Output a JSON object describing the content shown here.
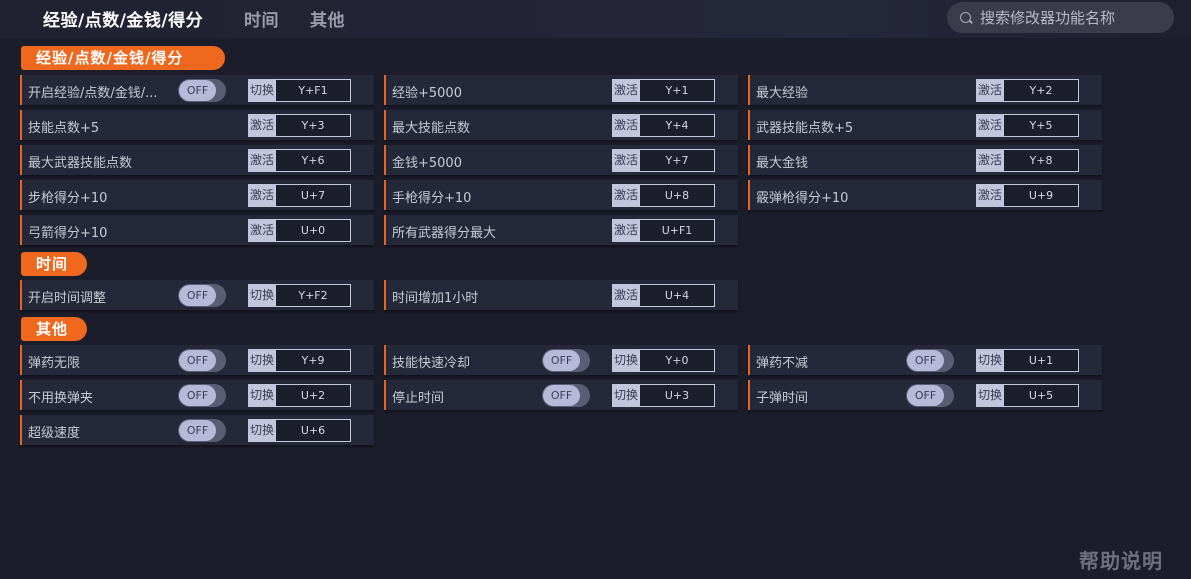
{
  "tabs": [
    {
      "label": "经验/点数/金钱/得分",
      "active": true
    },
    {
      "label": "时间",
      "active": false
    },
    {
      "label": "其他",
      "active": false
    }
  ],
  "search": {
    "placeholder": "搜索修改器功能名称"
  },
  "sections": [
    {
      "title": "经验/点数/金钱/得分",
      "rows": [
        {
          "label": "开启经验/点数/金钱/...",
          "toggle": "OFF",
          "action": "切换",
          "key": "Y+F1"
        },
        {
          "label": "经验+5000",
          "action": "激活",
          "key": "Y+1"
        },
        {
          "label": "最大经验",
          "action": "激活",
          "key": "Y+2"
        },
        {
          "label": "技能点数+5",
          "action": "激活",
          "key": "Y+3"
        },
        {
          "label": "最大技能点数",
          "action": "激活",
          "key": "Y+4"
        },
        {
          "label": "武器技能点数+5",
          "action": "激活",
          "key": "Y+5"
        },
        {
          "label": "最大武器技能点数",
          "action": "激活",
          "key": "Y+6"
        },
        {
          "label": "金钱+5000",
          "action": "激活",
          "key": "Y+7"
        },
        {
          "label": "最大金钱",
          "action": "激活",
          "key": "Y+8"
        },
        {
          "label": "步枪得分+10",
          "action": "激活",
          "key": "U+7"
        },
        {
          "label": "手枪得分+10",
          "action": "激活",
          "key": "U+8"
        },
        {
          "label": "霰弹枪得分+10",
          "action": "激活",
          "key": "U+9"
        },
        {
          "label": "弓箭得分+10",
          "action": "激活",
          "key": "U+0"
        },
        {
          "label": "所有武器得分最大",
          "action": "激活",
          "key": "U+F1"
        }
      ]
    },
    {
      "title": "时间",
      "rows": [
        {
          "label": "开启时间调整",
          "toggle": "OFF",
          "action": "切换",
          "key": "Y+F2"
        },
        {
          "label": "时间增加1小时",
          "action": "激活",
          "key": "U+4"
        }
      ]
    },
    {
      "title": "其他",
      "rows": [
        {
          "label": "弹药无限",
          "toggle": "OFF",
          "action": "切换",
          "key": "Y+9"
        },
        {
          "label": "技能快速冷却",
          "toggle": "OFF",
          "action": "切换",
          "key": "Y+0"
        },
        {
          "label": "弹药不减",
          "toggle": "OFF",
          "action": "切换",
          "key": "U+1"
        },
        {
          "label": "不用换弹夹",
          "toggle": "OFF",
          "action": "切换",
          "key": "U+2"
        },
        {
          "label": "停止时间",
          "toggle": "OFF",
          "action": "切换",
          "key": "U+3"
        },
        {
          "label": "子弹时间",
          "toggle": "OFF",
          "action": "切换",
          "key": "U+5"
        },
        {
          "label": "超级速度",
          "toggle": "OFF",
          "action": "切换",
          "key": "U+6"
        }
      ]
    }
  ],
  "help_label": "帮助说明",
  "colors": {
    "accent": "#f0681e",
    "background": "#1c1d2b",
    "row_bg": "#252838"
  }
}
